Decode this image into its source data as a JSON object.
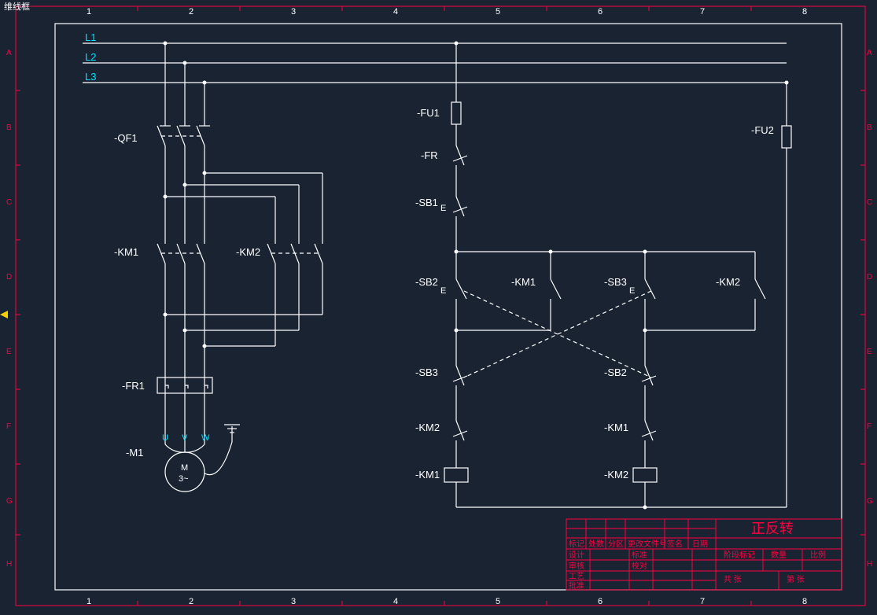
{
  "cornerLabel": "维线框",
  "ruler": {
    "cols": [
      "1",
      "2",
      "3",
      "4",
      "5",
      "6",
      "7",
      "8"
    ],
    "rows": [
      "A",
      "B",
      "C",
      "D",
      "E",
      "F",
      "G",
      "H"
    ]
  },
  "lines": {
    "L1": "L1",
    "L2": "L2",
    "L3": "L3"
  },
  "power": {
    "QF1": "-QF1",
    "KM1": "-KM1",
    "KM2": "-KM2",
    "FR1": "-FR1",
    "M1": "-M1",
    "U": "U",
    "V": "V",
    "W": "W",
    "Mtxt": "M",
    "M3": "3~"
  },
  "ctrl": {
    "FU1": "-FU1",
    "FU2": "-FU2",
    "FR": "-FR",
    "SB1": "-SB1",
    "SB2": "-SB2",
    "SB3": "-SB3",
    "KM1": "-KM1",
    "KM2": "-KM2",
    "E": "E"
  },
  "title": {
    "main": "正反转",
    "hdr": [
      "标记",
      "处数",
      "分区",
      "更改文件号",
      "签名",
      "日期"
    ],
    "col2": [
      "阶段标记",
      "数量",
      "比例"
    ],
    "rows": [
      "设计",
      "审核",
      "工艺",
      "批准"
    ],
    "misc": [
      "标准",
      "校对",
      "共   张",
      "第   张"
    ]
  }
}
